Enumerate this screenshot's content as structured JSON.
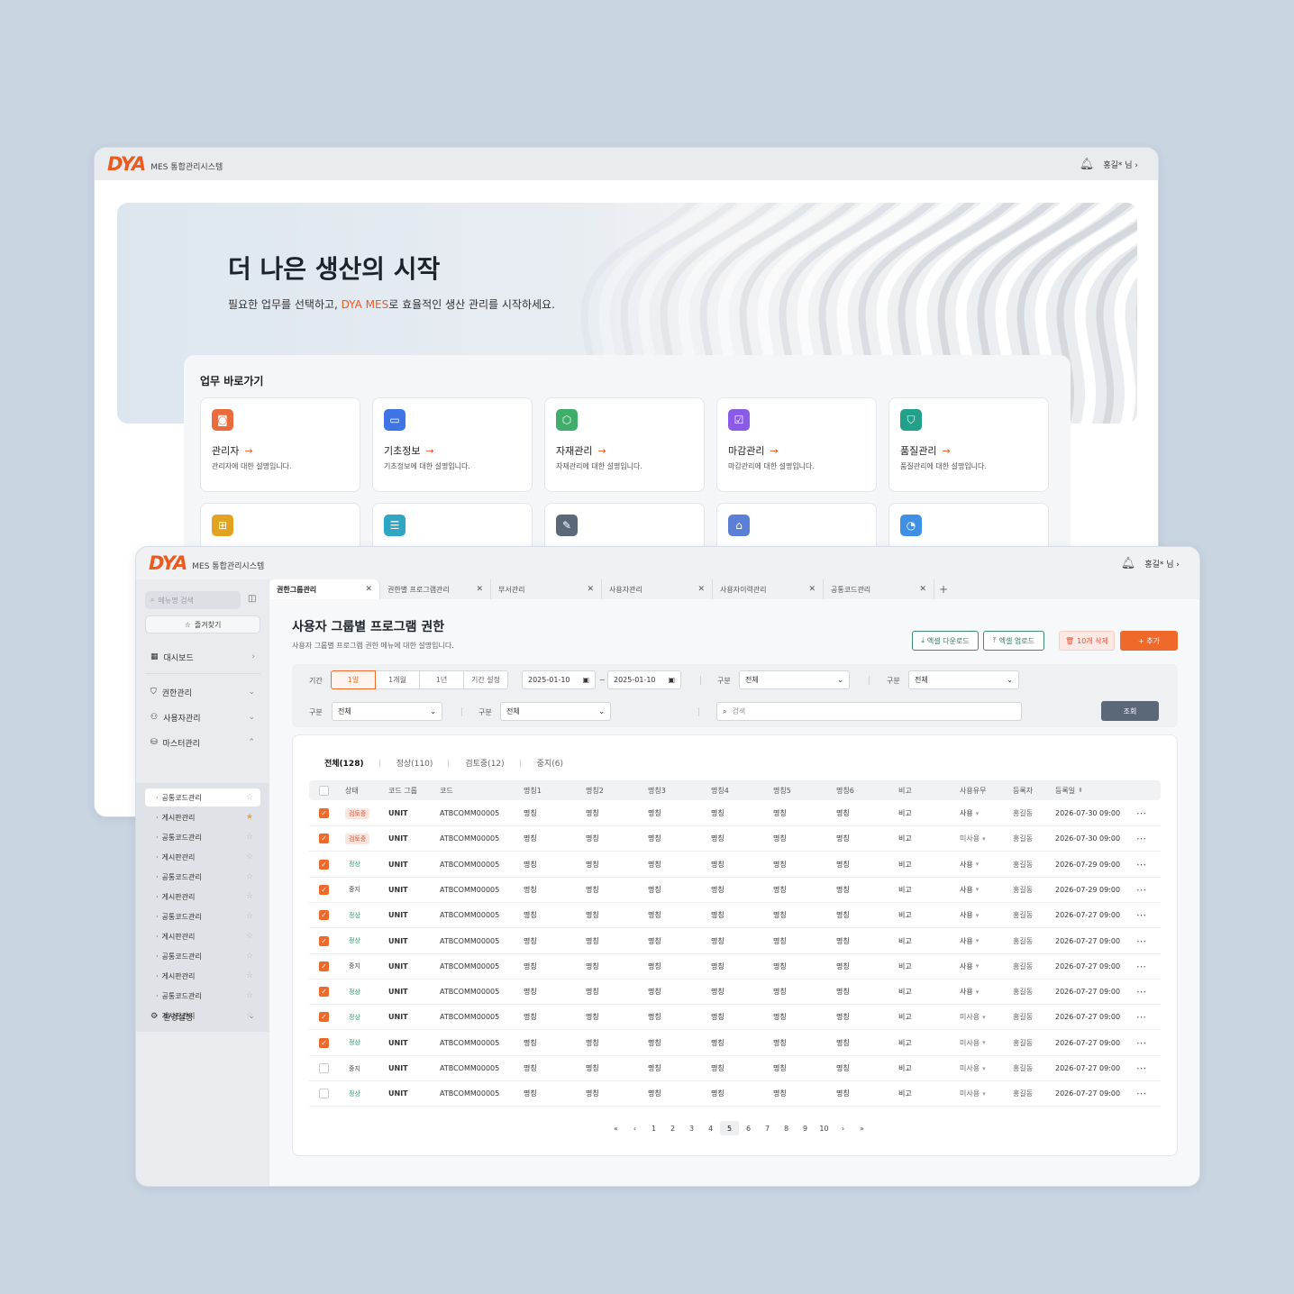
{
  "app": {
    "logo": "DYA",
    "system_name": "MES 통합관리시스템",
    "user_label": "홍길* 님",
    "user_chevron": "›"
  },
  "colors": {
    "accent": "#ec5a20",
    "primary_button": "#ef6a2a",
    "excel_button": "#2f7a5d",
    "search_button": "#5b6878"
  },
  "home": {
    "hero_title": "더 나은 생산의 시작",
    "hero_sub_prefix": "필요한 업무를 선택하고, ",
    "hero_sub_accent": "DYA MES",
    "hero_sub_suffix": "로 효율적인 생산 관리를 시작하세요.",
    "quick_title": "업무 바로가기",
    "arrow": "→",
    "cards": [
      {
        "name": "관리자",
        "desc": "관리자에 대한 설명입니다.",
        "icon": "user-card-icon",
        "color": "#ec6b3c"
      },
      {
        "name": "기초정보",
        "desc": "기초정보에 대한 설명입니다.",
        "icon": "folder-icon",
        "color": "#3f74e6"
      },
      {
        "name": "자재관리",
        "desc": "자재관리에 대한 설명입니다.",
        "icon": "box-icon",
        "color": "#3fae6a"
      },
      {
        "name": "마감관리",
        "desc": "마감관리에 대한 설명입니다.",
        "icon": "clipboard-check-icon",
        "color": "#8a5be6"
      },
      {
        "name": "품질관리",
        "desc": "품질관리에 대한 설명입니다.",
        "icon": "shield-check-icon",
        "color": "#23a08a"
      }
    ],
    "cards_row2_icons": [
      {
        "icon": "hierarchy-icon",
        "color": "#e3a21f"
      },
      {
        "icon": "server-icon",
        "color": "#2fa7c4"
      },
      {
        "icon": "wrench-icon",
        "color": "#5b6878"
      },
      {
        "icon": "factory-icon",
        "color": "#5b7fd6"
      },
      {
        "icon": "chart-search-icon",
        "color": "#3f8fe6"
      }
    ]
  },
  "sidebar": {
    "search_placeholder": "메뉴명 검색",
    "favorites_label": "즐겨찾기",
    "dashboard": "대시보드",
    "groups": [
      {
        "label": "권한관리",
        "icon": "shield-icon"
      },
      {
        "label": "사용자관리",
        "icon": "users-icon"
      },
      {
        "label": "마스터관리",
        "icon": "database-icon"
      }
    ],
    "sub_items": [
      {
        "label": "공통코드관리",
        "starred": false,
        "active": true
      },
      {
        "label": "게시판관리",
        "starred": true,
        "active": false
      },
      {
        "label": "공통코드관리",
        "starred": false,
        "active": false
      },
      {
        "label": "게시판관리",
        "starred": false,
        "active": false
      },
      {
        "label": "공통코드관리",
        "starred": false,
        "active": false
      },
      {
        "label": "게시판관리",
        "starred": false,
        "active": false
      },
      {
        "label": "공통코드관리",
        "starred": false,
        "active": false
      },
      {
        "label": "게시판관리",
        "starred": false,
        "active": false
      },
      {
        "label": "공통코드관리",
        "starred": false,
        "active": false
      },
      {
        "label": "게시판관리",
        "starred": false,
        "active": false
      },
      {
        "label": "공통코드관리",
        "starred": false,
        "active": false
      },
      {
        "label": "게시판관리",
        "starred": false,
        "active": false
      }
    ],
    "settings": "환경설정"
  },
  "tabs": [
    "권한그룹관리",
    "권한별 프로그램관리",
    "부서관리",
    "사용자관리",
    "사용자이력관리",
    "공통코드관리"
  ],
  "page": {
    "title": "사용자 그룹별 프로그램 권한",
    "subtitle": "사용자 그룹별 프로그램 권한 메뉴에 대한 설명입니다.",
    "btn_excel_down": "엑셀 다운로드",
    "btn_excel_up": "엑셀 업로드",
    "btn_delete": "10개 삭제",
    "btn_add": "+ 추가"
  },
  "filters": {
    "period_label": "기간",
    "period_options": [
      "1일",
      "1개월",
      "1년",
      "기간 설정"
    ],
    "period_selected": 0,
    "date_from": "2025-01-10",
    "date_to": "2025-01-10",
    "tilde": "~",
    "type_label": "구분",
    "select_all": "전체",
    "search_placeholder": "검색",
    "search_button": "조회"
  },
  "status_tabs": [
    "전체(128)",
    "정상(110)",
    "검토중(12)",
    "중지(6)"
  ],
  "table": {
    "columns": [
      "상태",
      "코드 그룹",
      "코드",
      "명칭1",
      "명칭2",
      "명칭3",
      "명칭4",
      "명칭5",
      "명칭6",
      "비고",
      "사용유무",
      "등록자",
      "등록일"
    ],
    "rows": [
      {
        "checked": true,
        "status": "검토중",
        "group": "UNIT",
        "code": "ATBCOMM00005",
        "n1": "명칭",
        "n2": "명칭",
        "n3": "명칭",
        "n4": "명칭",
        "n5": "명칭",
        "n6": "명칭",
        "note": "비고",
        "use": "사용",
        "user": "홍길동",
        "date": "2026-07-30 09:00"
      },
      {
        "checked": true,
        "status": "검토중",
        "group": "UNIT",
        "code": "ATBCOMM00005",
        "n1": "명칭",
        "n2": "명칭",
        "n3": "명칭",
        "n4": "명칭",
        "n5": "명칭",
        "n6": "명칭",
        "note": "비고",
        "use": "미사용",
        "user": "홍길동",
        "date": "2026-07-30 09:00"
      },
      {
        "checked": true,
        "status": "정상",
        "group": "UNIT",
        "code": "ATBCOMM00005",
        "n1": "명칭",
        "n2": "명칭",
        "n3": "명칭",
        "n4": "명칭",
        "n5": "명칭",
        "n6": "명칭",
        "note": "비고",
        "use": "사용",
        "user": "홍길동",
        "date": "2026-07-29 09:00"
      },
      {
        "checked": true,
        "status": "중지",
        "group": "UNIT",
        "code": "ATBCOMM00005",
        "n1": "명칭",
        "n2": "명칭",
        "n3": "명칭",
        "n4": "명칭",
        "n5": "명칭",
        "n6": "명칭",
        "note": "비고",
        "use": "사용",
        "user": "홍길동",
        "date": "2026-07-29 09:00"
      },
      {
        "checked": true,
        "status": "정상",
        "group": "UNIT",
        "code": "ATBCOMM00005",
        "n1": "명칭",
        "n2": "명칭",
        "n3": "명칭",
        "n4": "명칭",
        "n5": "명칭",
        "n6": "명칭",
        "note": "비고",
        "use": "사용",
        "user": "홍길동",
        "date": "2026-07-27 09:00"
      },
      {
        "checked": true,
        "status": "정상",
        "group": "UNIT",
        "code": "ATBCOMM00005",
        "n1": "명칭",
        "n2": "명칭",
        "n3": "명칭",
        "n4": "명칭",
        "n5": "명칭",
        "n6": "명칭",
        "note": "비고",
        "use": "사용",
        "user": "홍길동",
        "date": "2026-07-27 09:00"
      },
      {
        "checked": true,
        "status": "중지",
        "group": "UNIT",
        "code": "ATBCOMM00005",
        "n1": "명칭",
        "n2": "명칭",
        "n3": "명칭",
        "n4": "명칭",
        "n5": "명칭",
        "n6": "명칭",
        "note": "비고",
        "use": "사용",
        "user": "홍길동",
        "date": "2026-07-27 09:00"
      },
      {
        "checked": true,
        "status": "정상",
        "group": "UNIT",
        "code": "ATBCOMM00005",
        "n1": "명칭",
        "n2": "명칭",
        "n3": "명칭",
        "n4": "명칭",
        "n5": "명칭",
        "n6": "명칭",
        "note": "비고",
        "use": "사용",
        "user": "홍길동",
        "date": "2026-07-27 09:00"
      },
      {
        "checked": true,
        "status": "정상",
        "group": "UNIT",
        "code": "ATBCOMM00005",
        "n1": "명칭",
        "n2": "명칭",
        "n3": "명칭",
        "n4": "명칭",
        "n5": "명칭",
        "n6": "명칭",
        "note": "비고",
        "use": "미사용",
        "user": "홍길동",
        "date": "2026-07-27 09:00"
      },
      {
        "checked": true,
        "status": "정상",
        "group": "UNIT",
        "code": "ATBCOMM00005",
        "n1": "명칭",
        "n2": "명칭",
        "n3": "명칭",
        "n4": "명칭",
        "n5": "명칭",
        "n6": "명칭",
        "note": "비고",
        "use": "미사용",
        "user": "홍길동",
        "date": "2026-07-27 09:00"
      },
      {
        "checked": false,
        "status": "중지",
        "group": "UNIT",
        "code": "ATBCOMM00005",
        "n1": "명칭",
        "n2": "명칭",
        "n3": "명칭",
        "n4": "명칭",
        "n5": "명칭",
        "n6": "명칭",
        "note": "비고",
        "use": "미사용",
        "user": "홍길동",
        "date": "2026-07-27 09:00"
      },
      {
        "checked": false,
        "status": "정상",
        "group": "UNIT",
        "code": "ATBCOMM00005",
        "n1": "명칭",
        "n2": "명칭",
        "n3": "명칭",
        "n4": "명칭",
        "n5": "명칭",
        "n6": "명칭",
        "note": "비고",
        "use": "미사용",
        "user": "홍길동",
        "date": "2026-07-27 09:00"
      }
    ]
  },
  "pagination": {
    "first": "«",
    "prev": "‹",
    "next": "›",
    "last": "»",
    "pages": [
      "1",
      "2",
      "3",
      "4",
      "5",
      "6",
      "7",
      "8",
      "9",
      "10"
    ],
    "current": "5"
  }
}
